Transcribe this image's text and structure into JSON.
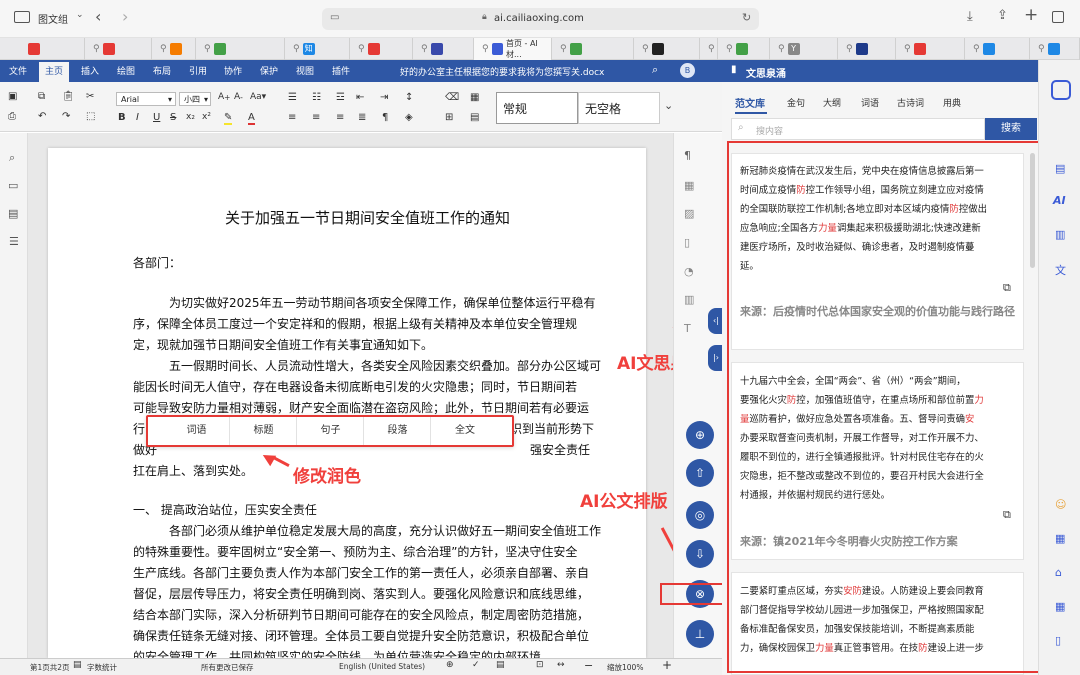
{
  "browser": {
    "sidebar_label": "图文组",
    "url": "ai.cailiaoxing.com",
    "active_tab": "首页 - AI材...",
    "tabs": [
      {
        "label": "",
        "color": "#e53935"
      },
      {
        "label": "",
        "color": "#e53935"
      },
      {
        "label": "",
        "color": "#f57c00"
      },
      {
        "label": "",
        "color": "#43a047"
      },
      {
        "label": "知",
        "color": "#1e88e5"
      },
      {
        "label": "",
        "color": "#e53935"
      },
      {
        "label": "",
        "color": "#3949ab"
      },
      {
        "label": "首页 - AI材...",
        "color": "#3b5bd6"
      },
      {
        "label": "",
        "color": "#43a047"
      },
      {
        "label": "",
        "color": "#222222"
      },
      {
        "label": "",
        "color": "#43a047"
      },
      {
        "label": "",
        "color": "#43a047"
      },
      {
        "label": "Y",
        "color": "#888888"
      },
      {
        "label": "",
        "color": "#1e3a8a"
      },
      {
        "label": "",
        "color": "#e53935"
      },
      {
        "label": "",
        "color": "#1e88e5"
      },
      {
        "label": "",
        "color": "#1e88e5"
      }
    ]
  },
  "word": {
    "menu": [
      "文件",
      "主页",
      "插入",
      "绘图",
      "布局",
      "引用",
      "协作",
      "保护",
      "视图",
      "插件"
    ],
    "active_menu": "主页",
    "doc_title": "好的办公室主任根据您的要求我将为您撰写关.docx",
    "font_name": "Arial",
    "font_size": "小四",
    "style_normal": "常规",
    "style_nospace": "无空格"
  },
  "document": {
    "title": "关于加强五一节日期间安全值班工作的通知",
    "greeting": "各部门：",
    "p1": [
      "为切实做好2025年五一劳动节期间各项安全保障工作，确保单位整体运行平稳有",
      "序，保障全体员工度过一个安定祥和的假期，根据上级有关精神及本单位安全管理规",
      "定，现就加强节日期间安全值班工作有关事宜通知如下。"
    ],
    "p2": [
      "五一假期时间长、人员流动性增大，各类安全风险因素交织叠加。部分办公区域可",
      "能因长时间无人值守，存在电器设备未彻底断电引发的火灾隐患；同时，节日期间若",
      "可能导致安防力量相对薄弱，财产安全面临潜在盗窃风险；此外，节日期间若有必要运",
      "行的",
      "识到当前形势下",
      "做好",
      "强安全责任",
      "扛在肩上、落到实处。"
    ],
    "section1_heading": "一、 提高政治站位，压实安全责任",
    "p3": [
      "各部门必须从维护单位稳定发展大局的高度，充分认识做好五一期间安全值班工作",
      "的特殊重要性。要牢固树立“安全第一、预防为主、综合治理”的方针，坚决守住安全",
      "生产底线。各部门主要负责人作为本部门安全工作的第一责任人，必须亲自部署、亲自",
      "督促，层层传导压力，将安全责任明确到岗、落实到人。要强化风险意识和底线思维，",
      "结合本部门实际，深入分析研判节日期间可能存在的安全风险点，制定周密防范措施，",
      "确保责任链条无缝对接、闭环管理。全体员工要自觉提升安全防范意识，积极配合单位",
      "的安全管理工作，共同构筑坚实的安全防线，为单位营造安全稳定的内部环境。"
    ]
  },
  "polish_toolbar": [
    "词语",
    "标题",
    "句子",
    "段落",
    "全文"
  ],
  "annotations": {
    "polish": "修改润色",
    "library": "AI文思泉涌",
    "layout": "AI公文排版"
  },
  "statusbar": {
    "page": "第1页共2页",
    "wordcount": "字数统计",
    "saved": "所有更改已保存",
    "language": "English (United States)",
    "zoom": "缩放100%"
  },
  "panel": {
    "title": "文思泉涌",
    "tabs": [
      "范文库",
      "金句",
      "大纲",
      "词语",
      "古诗词",
      "用典"
    ],
    "active_tab": "范文库",
    "search_placeholder": "搜内容",
    "search_button": "搜索",
    "cards": [
      {
        "lines": [
          [
            {
              "t": "新冠肺炎疫情在武汉发生后，党中央在疫情信息披露后第一"
            }
          ],
          [
            {
              "t": "时间成立疫情"
            },
            {
              "t": "防",
              "r": true
            },
            {
              "t": "控工作领导小组，国务院立刻建立应对疫情"
            }
          ],
          [
            {
              "t": "的全国联防联控工作机制;各地立即对本区域内疫情"
            },
            {
              "t": "防",
              "r": true
            },
            {
              "t": "控做出"
            }
          ],
          [
            {
              "t": "应急响应;全国各方"
            },
            {
              "t": "力量",
              "r": true
            },
            {
              "t": "调集起来积极援助湖北;快速改建新"
            }
          ],
          [
            {
              "t": "建医疗场所，及时收治疑似、确诊患者，及时遏制疫情蔓"
            }
          ],
          [
            {
              "t": "延。"
            }
          ]
        ],
        "source": "来源：后疫情时代总体国家安全观的价值功能与践行路径"
      },
      {
        "lines": [
          [
            {
              "t": "十九届六中全会，全国“两会”、省（州）“两会”期间，"
            }
          ],
          [
            {
              "t": "要强化火灾"
            },
            {
              "t": "防",
              "r": true
            },
            {
              "t": "控，加强值班值守，在重点场所和部位前置"
            },
            {
              "t": "力",
              "r": true
            }
          ],
          [
            {
              "t": "量",
              "r": true
            },
            {
              "t": "巡防看护，做好应急处置各项准备。五、督导问责确"
            },
            {
              "t": "安",
              "r": true
            }
          ],
          [
            {
              "t": "办要采取督查问责机制，开展工作督导，对工作开展不力、"
            }
          ],
          [
            {
              "t": "履职不到位的，进行全镇通报批评。针对村民住宅存在的火"
            }
          ],
          [
            {
              "t": "灾隐患，拒不整改或整改不到位的，要召开村民大会进行全"
            }
          ],
          [
            {
              "t": "村通报，并依据村规民约进行惩处。"
            }
          ]
        ],
        "source": "来源：镇2021年今冬明春火灾防控工作方案"
      },
      {
        "lines": [
          [
            {
              "t": "二要紧盯重点区域，夯实"
            },
            {
              "t": "安防",
              "r": true
            },
            {
              "t": "建设。人防建设上要会同教育"
            }
          ],
          [
            {
              "t": "部门督促指导学校幼儿园进一步加强保卫，严格按照国家配"
            }
          ],
          [
            {
              "t": "备标准配备保安员，加强安保技能培训，不断提高素质能"
            }
          ],
          [
            {
              "t": "力，确保校园保卫"
            },
            {
              "t": "力量",
              "r": true
            },
            {
              "t": "真正管事管用。在技"
            },
            {
              "t": "防",
              "r": true
            },
            {
              "t": "建设上进一步"
            }
          ]
        ],
        "source": ""
      }
    ]
  },
  "colors": {
    "accent": "#2f57a5",
    "highlight": "#f0403c",
    "keyword": "#e03b3b"
  }
}
